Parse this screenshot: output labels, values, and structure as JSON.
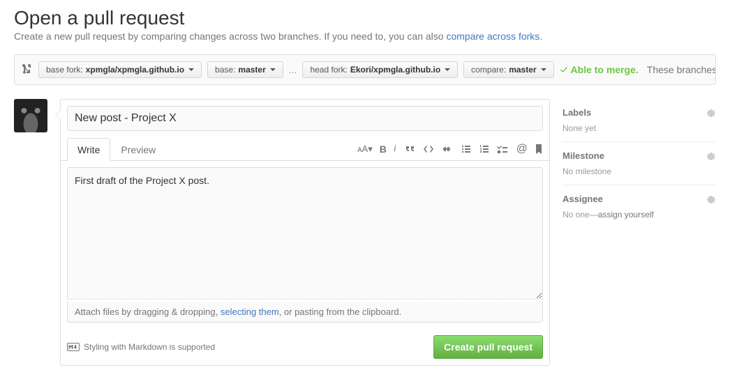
{
  "header": {
    "title": "Open a pull request",
    "subtitle_pre": "Create a new pull request by comparing changes across two branches. If you need to, you can also ",
    "subtitle_link": "compare across forks",
    "subtitle_post": "."
  },
  "compare": {
    "base_fork_label": "base fork: ",
    "base_fork_value": "xpmgla/xpmgla.github.io",
    "base_label": "base: ",
    "base_value": "master",
    "ellipsis": "...",
    "head_fork_label": "head fork: ",
    "head_fork_value": "Ekori/xpmgla.github.io",
    "compare_label": "compare: ",
    "compare_value": "master",
    "merge_ok": "Able to merge.",
    "merge_text": "These branches"
  },
  "editor": {
    "title_value": "New post - Project X",
    "tab_write": "Write",
    "tab_preview": "Preview",
    "body_value": "First draft of the Project X post.",
    "attach_pre": "Attach files by dragging & dropping, ",
    "attach_link": "selecting them",
    "attach_post": ", or pasting from the clipboard.",
    "md_hint": "Styling with Markdown is supported",
    "submit": "Create pull request"
  },
  "sidebar": {
    "labels": {
      "title": "Labels",
      "value": "None yet"
    },
    "milestone": {
      "title": "Milestone",
      "value": "No milestone"
    },
    "assignee": {
      "title": "Assignee",
      "value_pre": "No one—",
      "value_link": "assign yourself"
    }
  },
  "toolbar": {
    "text_size": "ᴀA",
    "bold": "B",
    "italic": "i",
    "at": "@"
  }
}
